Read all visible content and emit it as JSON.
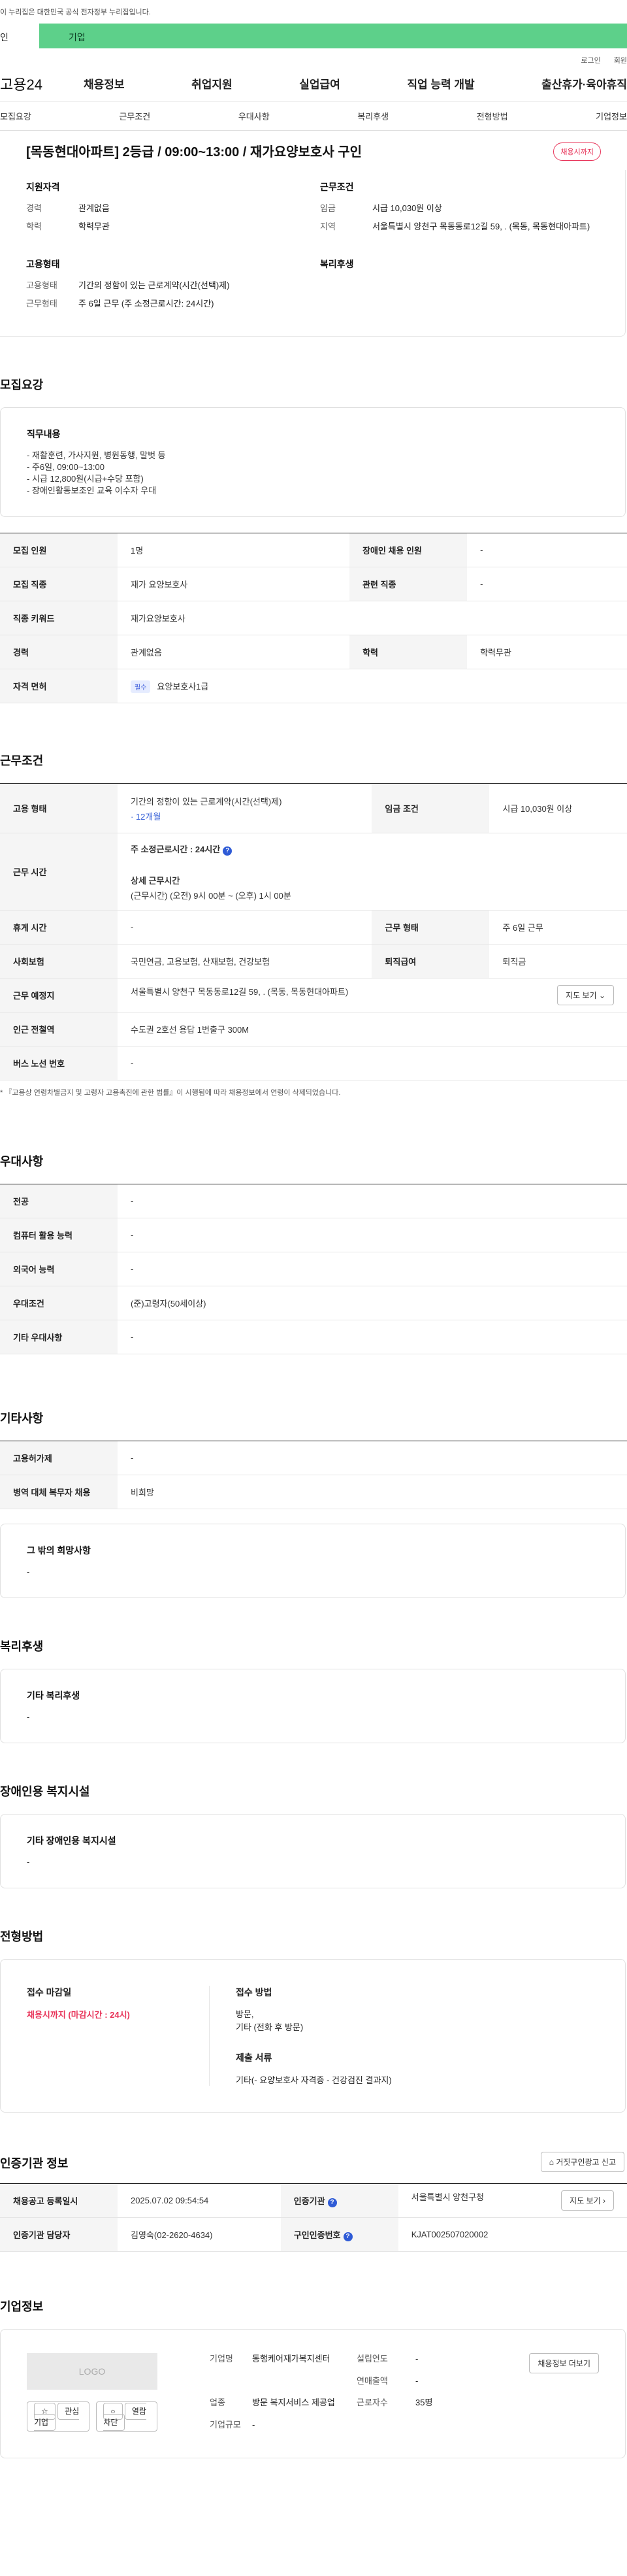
{
  "gov_notice": "이 누리집은 대한민국 공식 전자정부 누리집입니다.",
  "audience_tabs": {
    "individual": "인",
    "company": "기업"
  },
  "util_links": {
    "login": "로그인",
    "signup": "회원"
  },
  "brand": "고용24",
  "nav": [
    "채용정보",
    "취업지원",
    "실업급여",
    "직업 능력 개발",
    "출산휴가·육아휴직"
  ],
  "sub_nav": [
    "모집요강",
    "근무조건",
    "우대사항",
    "복리후생",
    "전형방법",
    "기업정보"
  ],
  "job_title": "[목동현대아파트] 2등급 / 09:00~13:00 / 재가요양보호사 구인",
  "job_status": "채용시까지",
  "summary": {
    "qualification": {
      "heading": "지원자격",
      "rows": [
        {
          "k": "경력",
          "v": "관계없음"
        },
        {
          "k": "학력",
          "v": "학력무관"
        }
      ]
    },
    "conditions": {
      "heading": "근무조건",
      "rows": [
        {
          "k": "임금",
          "v": "시급 10,030원 이상"
        },
        {
          "k": "지역",
          "v": "서울특별시 양천구 목동동로12길 59, . (목동, 목동현대아파트)"
        }
      ]
    },
    "employment": {
      "heading": "고용형태",
      "rows": [
        {
          "k": "고용형태",
          "v": "기간의 정함이 있는 근로계약(시간(선택)제)"
        },
        {
          "k": "근무형태",
          "v": "주 6일 근무 (주 소정근로시간: 24시간)"
        }
      ]
    },
    "welfare": {
      "heading": "복리후생"
    }
  },
  "recruit": {
    "section_title": "모집요강",
    "duty_heading": "직무내용",
    "duty_body": "- 재활훈련, 가사지원, 병원동행, 말벗 등\n- 주6일, 09:00~13:00\n- 시급 12,800원(시급+수당 포함)\n- 장애인활동보조인 교육 이수자 우대",
    "table": [
      [
        "모집 인원",
        "1명",
        "장애인 채용 인원",
        "-"
      ],
      [
        "모집 직종",
        "재가 요양보호사",
        "관련 직종",
        "-"
      ],
      [
        "직종 키워드",
        "재가요양보호사"
      ],
      [
        "경력",
        "관계없음",
        "학력",
        "학력무관"
      ]
    ],
    "license_label": "자격 면허",
    "license_badge": "필수",
    "license_value": "요양보호사1급"
  },
  "work": {
    "section_title": "근무조건",
    "employ_type_label": "고용 형태",
    "employ_type_value": "기간의 정함이 있는 근로계약(시간(선택)제)",
    "employ_type_period": "· 12개월",
    "wage_label": "임금 조건",
    "wage_value": "시급 10,030원 이상",
    "hours_label": "근무 시간",
    "hours_weekly": "주 소정근로시간 : 24시간",
    "hours_detail_title": "상세 근무시간",
    "hours_detail": "(근무시간) (오전) 9시 00분 ~ (오후) 1시 00분",
    "rest_label": "휴게 시간",
    "rest_value": "-",
    "shift_label": "근무 형태",
    "shift_value": "주 6일 근무",
    "insurance_label": "사회보험",
    "insurance_value": "국민연금, 고용보험, 산재보험, 건강보험",
    "severance_label": "퇴직급여",
    "severance_value": "퇴직금",
    "location_label": "근무 예정지",
    "location_value": "서울특별시 양천구 목동동로12길 59, . (목동, 목동현대아파트)",
    "map_button": "지도 보기",
    "subway_label": "인근 전철역",
    "subway_value": "수도권 2호선 용답 1번출구 300M",
    "bus_label": "버스 노선 번호",
    "bus_value": "-",
    "note": "* 『고용상 연령차별금지 및 고령자 고용촉진에 관한 법률』이 시행됨에 따라 채용정보에서 연령이 삭제되었습니다."
  },
  "prefer": {
    "section_title": "우대사항",
    "rows": [
      [
        "전공",
        "-"
      ],
      [
        "컴퓨터 활용 능력",
        "-"
      ],
      [
        "외국어 능력",
        "-"
      ],
      [
        "우대조건",
        "(준)고령자(50세이상)"
      ],
      [
        "기타 우대사항",
        "-"
      ]
    ]
  },
  "etc": {
    "section_title": "기타사항",
    "rows": [
      [
        "고용허가제",
        "-"
      ],
      [
        "병역 대체 복무자 채용",
        "비희망"
      ]
    ],
    "other_heading": "그 밖의 희망사항",
    "other_body": "-"
  },
  "benefits": {
    "section_title": "복리후생",
    "heading": "기타 복리후생",
    "body": "-"
  },
  "disability": {
    "section_title": "장애인용 복지시설",
    "heading": "기타 장애인용 복지시설",
    "body": "-"
  },
  "method": {
    "section_title": "전형방법",
    "deadline_heading": "접수 마감일",
    "deadline_value": "채용시까지 (마감시간 : 24시)",
    "apply_heading": "접수 방법",
    "apply_value": "방문,\n기타 (전화 후 방문)",
    "docs_heading": "제출 서류",
    "docs_value": "기타(- 요양보호사 자격증 - 건강검진 결과지)"
  },
  "cert": {
    "section_title": "인증기관 정보",
    "report_button": "거짓구인광고 신고",
    "rows": {
      "reg_label": "채용공고 등록일시",
      "reg_value": "2025.07.02 09:54:54",
      "agency_label": "인증기관",
      "agency_value": "서울특별시 양천구청",
      "manager_label": "인증기관 담당자",
      "manager_value": "김영숙(02-2620-4634)",
      "cert_no_label": "구인인증번호",
      "cert_no_value": "KJAT002507020002"
    },
    "map_button": "지도 보기"
  },
  "company": {
    "section_title": "기업정보",
    "logo_text": "LOGO",
    "fav_button": "관심기업",
    "block_button": "열람차단",
    "name_label": "기업명",
    "name_value": "동행케어재가복지센터",
    "founded_label": "설립연도",
    "founded_value": "-",
    "revenue_label": "연매출액",
    "revenue_value": "-",
    "industry_label": "업종",
    "industry_value": "방문 복지서비스 제공업",
    "staff_label": "근로자수",
    "staff_value": "35명",
    "size_label": "기업규모",
    "size_value": "-",
    "hiring_button": "채용정보 더보기"
  }
}
